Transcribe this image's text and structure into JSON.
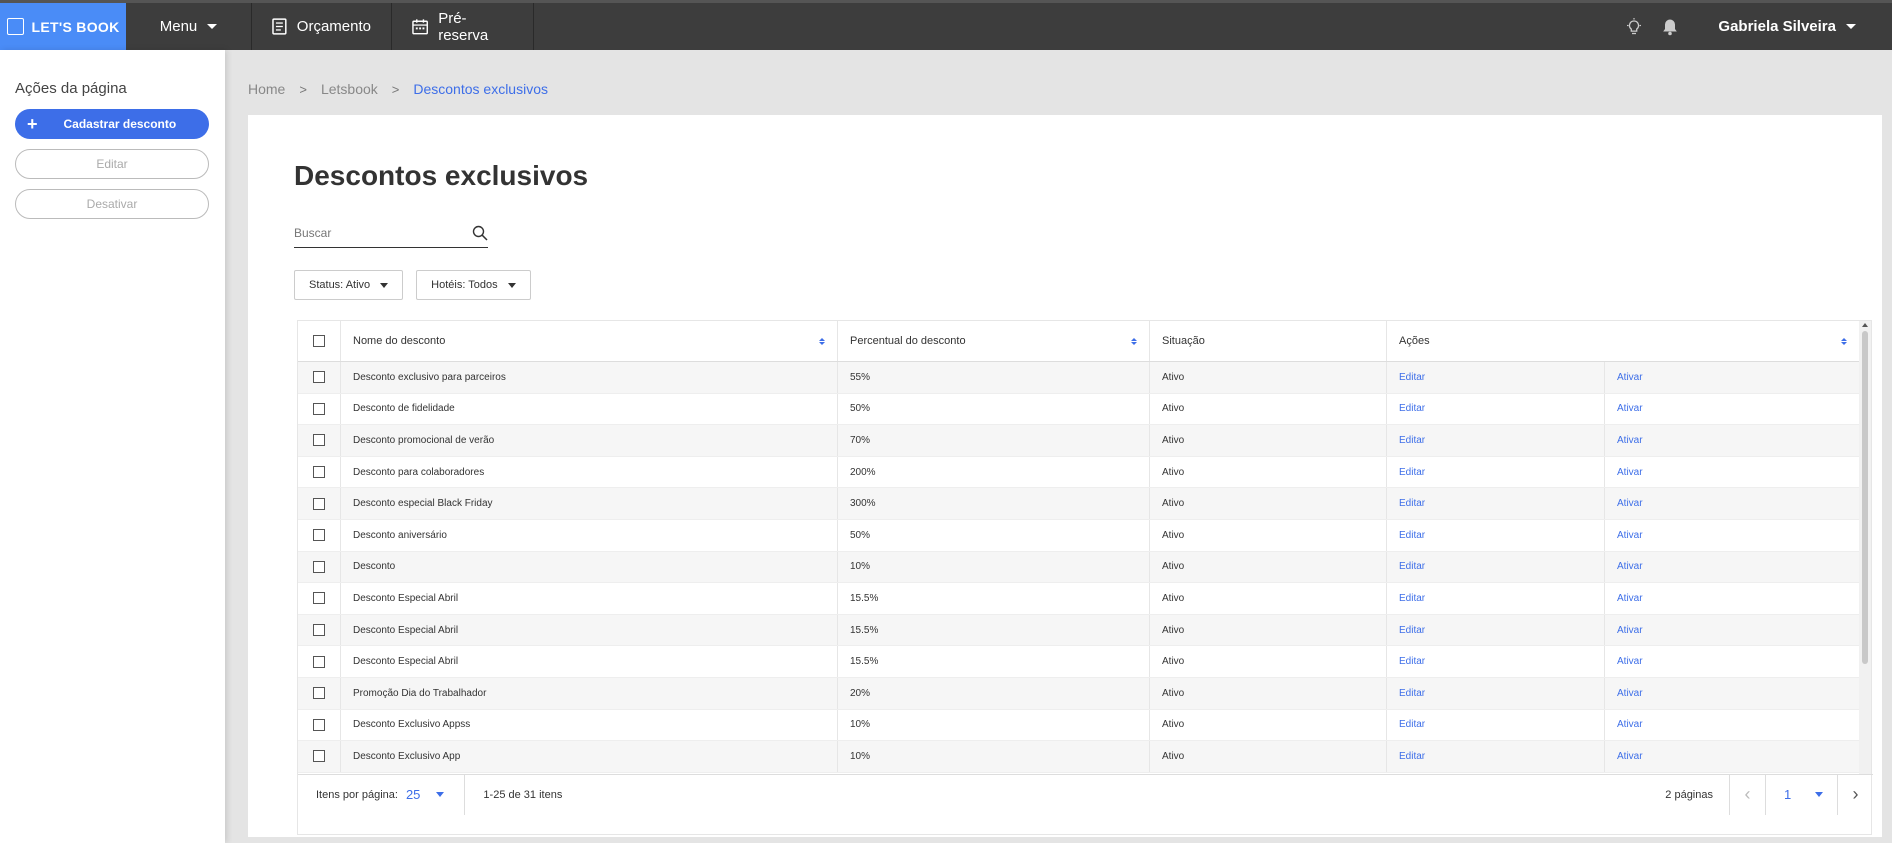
{
  "topbar": {
    "logo_text": "LET'S BOOK",
    "menu_label": "Menu",
    "nav": [
      {
        "label": "Orçamento",
        "icon": "document-icon"
      },
      {
        "label": "Pré-reserva",
        "icon": "calendar-icon"
      }
    ],
    "user_name": "Gabriela Silveira"
  },
  "sidebar": {
    "title": "Ações da página",
    "primary_button": "Cadastrar desconto",
    "edit_button": "Editar",
    "deactivate_button": "Desativar"
  },
  "breadcrumb": [
    "Home",
    "Letsbook",
    "Descontos exclusivos"
  ],
  "page": {
    "title": "Descontos exclusivos",
    "search_placeholder": "Buscar",
    "filters": [
      "Status: Ativo",
      "Hotéis: Todos"
    ]
  },
  "table": {
    "headers": [
      "Nome do desconto",
      "Percentual do desconto",
      "Situação",
      "Ações"
    ],
    "rows": [
      {
        "name": "Desconto exclusivo para parceiros",
        "pct": "55%",
        "status": "Ativo",
        "edit": "Editar",
        "action": "Ativar"
      },
      {
        "name": "Desconto de fidelidade",
        "pct": "50%",
        "status": "Ativo",
        "edit": "Editar",
        "action": "Ativar"
      },
      {
        "name": "Desconto promocional de verão",
        "pct": "70%",
        "status": "Ativo",
        "edit": "Editar",
        "action": "Ativar"
      },
      {
        "name": "Desconto para colaboradores",
        "pct": "200%",
        "status": "Ativo",
        "edit": "Editar",
        "action": "Ativar"
      },
      {
        "name": "Desconto especial Black Friday",
        "pct": "300%",
        "status": "Ativo",
        "edit": "Editar",
        "action": "Ativar"
      },
      {
        "name": "Desconto aniversário",
        "pct": "50%",
        "status": "Ativo",
        "edit": "Editar",
        "action": "Ativar"
      },
      {
        "name": "Desconto",
        "pct": "10%",
        "status": "Ativo",
        "edit": "Editar",
        "action": "Ativar"
      },
      {
        "name": "Desconto Especial Abril",
        "pct": "15.5%",
        "status": "Ativo",
        "edit": "Editar",
        "action": "Ativar"
      },
      {
        "name": "Desconto Especial Abril",
        "pct": "15.5%",
        "status": "Ativo",
        "edit": "Editar",
        "action": "Ativar"
      },
      {
        "name": "Desconto Especial Abril",
        "pct": "15.5%",
        "status": "Ativo",
        "edit": "Editar",
        "action": "Ativar"
      },
      {
        "name": "Promoção Dia do Trabalhador",
        "pct": "20%",
        "status": "Ativo",
        "edit": "Editar",
        "action": "Ativar"
      },
      {
        "name": "Desconto Exclusivo Appss",
        "pct": "10%",
        "status": "Ativo",
        "edit": "Editar",
        "action": "Ativar"
      },
      {
        "name": "Desconto Exclusivo App",
        "pct": "10%",
        "status": "Ativo",
        "edit": "Editar",
        "action": "Ativar"
      }
    ]
  },
  "pagination": {
    "per_page_label": "Itens por página:",
    "per_page_value": "25",
    "range": "1-25 de 31 itens",
    "pages_count": "2 páginas",
    "current_page": "1"
  },
  "colors": {
    "accent": "#3d6ee8",
    "logo_bg": "#4a8cf7",
    "topbar_bg": "#3d3d3d"
  }
}
